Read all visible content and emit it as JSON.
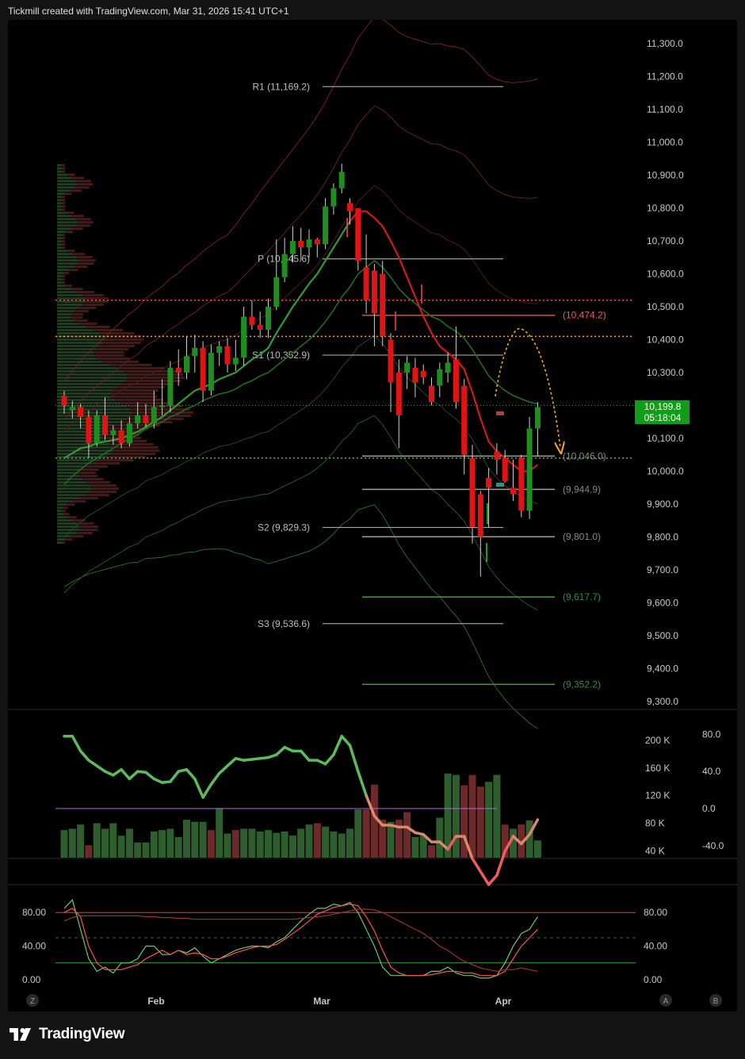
{
  "header": {
    "text": "Tickmill created with TradingView.com, Mar 31, 2026 15:41 UTC+1"
  },
  "brand": {
    "name": "TradingView",
    "icon": "tradingview-logo-icon"
  },
  "colors": {
    "up": "#1e8f1e",
    "down": "#e01414",
    "bg": "#000000",
    "price_badge": "#0f9d1a",
    "fib_orange": "#f5a623",
    "dotted_red": "#ff4444",
    "green_level": "#2a7a2a",
    "red_level": "#ff3b3b"
  },
  "price_badge": {
    "price": "10,199.8",
    "countdown": "05:18:04",
    "value": 10199.8
  },
  "pivots": [
    {
      "label": "R1 (11,169.2)",
      "value": 11169.2
    },
    {
      "label": "P (10,645.6)",
      "value": 10645.6
    },
    {
      "label": "S1 (10,352.9)",
      "value": 10352.9
    },
    {
      "label": "S2 (9,829.3)",
      "value": 9829.3
    },
    {
      "label": "S3 (9,536.6)",
      "value": 9536.6
    }
  ],
  "levels": [
    {
      "label": "(10,474.2)",
      "value": 10474.2,
      "color": "red"
    },
    {
      "label": "(10,046.0)",
      "value": 10046.0,
      "color": "gray"
    },
    {
      "label": "(9,944.9)",
      "value": 9944.9,
      "color": "gray"
    },
    {
      "label": "(9,801.0)",
      "value": 9801.0,
      "color": "gray"
    },
    {
      "label": "(9,617.7)",
      "value": 9617.7,
      "color": "green"
    },
    {
      "label": "(9,352.2)",
      "value": 9352.2,
      "color": "green"
    }
  ],
  "dotted_lines": [
    {
      "value": 10520,
      "color": "red"
    },
    {
      "value": 10410,
      "color": "orange"
    },
    {
      "value": 10040,
      "color": "green"
    },
    {
      "value": 10199.8,
      "color": "green"
    }
  ],
  "chart_data": [
    {
      "type": "candlestick",
      "title": "",
      "ylim": [
        9270,
        11330
      ],
      "y_ticks": [
        "11,300.0",
        "11,200.0",
        "11,100.0",
        "11,000.0",
        "10,900.0",
        "10,800.0",
        "10,700.0",
        "10,600.0",
        "10,500.0",
        "10,400.0",
        "10,300.0",
        "10,200.0",
        "10,100.0",
        "10,000.0",
        "9,900.0",
        "9,800.0",
        "9,700.0",
        "9,600.0",
        "9,500.0",
        "9,400.0",
        "9,300.0"
      ],
      "y_tick_values": [
        11300,
        11200,
        11100,
        11000,
        10900,
        10800,
        10700,
        10600,
        10500,
        10400,
        10300,
        10200,
        10100,
        10000,
        9900,
        9800,
        9700,
        9600,
        9500,
        9400,
        9300
      ],
      "x_ticks": [
        "Feb",
        "Mar",
        "Apr"
      ],
      "x_tick_index": [
        15,
        41,
        70.5
      ],
      "candles": [
        [
          10230,
          10245,
          10175,
          10200
        ],
        [
          10185,
          10215,
          10160,
          10195
        ],
        [
          10195,
          10205,
          10130,
          10165
        ],
        [
          10165,
          10185,
          10040,
          10085
        ],
        [
          10085,
          10185,
          10075,
          10170
        ],
        [
          10170,
          10225,
          10095,
          10110
        ],
        [
          10110,
          10140,
          10080,
          10125
        ],
        [
          10125,
          10155,
          10070,
          10085
        ],
        [
          10085,
          10165,
          10075,
          10145
        ],
        [
          10145,
          10210,
          10130,
          10170
        ],
        [
          10170,
          10205,
          10135,
          10145
        ],
        [
          10145,
          10245,
          10130,
          10195
        ],
        [
          10195,
          10280,
          10170,
          10200
        ],
        [
          10200,
          10335,
          10180,
          10315
        ],
        [
          10315,
          10370,
          10260,
          10300
        ],
        [
          10300,
          10410,
          10280,
          10350
        ],
        [
          10350,
          10415,
          10300,
          10375
        ],
        [
          10375,
          10395,
          10210,
          10245
        ],
        [
          10245,
          10385,
          10230,
          10360
        ],
        [
          10360,
          10395,
          10320,
          10380
        ],
        [
          10380,
          10405,
          10300,
          10325
        ],
        [
          10325,
          10400,
          10305,
          10345
        ],
        [
          10345,
          10500,
          10320,
          10470
        ],
        [
          10470,
          10520,
          10430,
          10445
        ],
        [
          10445,
          10485,
          10405,
          10430
        ],
        [
          10430,
          10525,
          10405,
          10500
        ],
        [
          10500,
          10705,
          10490,
          10590
        ],
        [
          10590,
          10710,
          10575,
          10660
        ],
        [
          10660,
          10745,
          10635,
          10700
        ],
        [
          10700,
          10740,
          10640,
          10680
        ],
        [
          10680,
          10735,
          10650,
          10705
        ],
        [
          10705,
          10710,
          10650,
          10690
        ],
        [
          10690,
          10830,
          10675,
          10805
        ],
        [
          10805,
          10875,
          10780,
          10860
        ],
        [
          10860,
          10935,
          10845,
          10910
        ],
        [
          10815,
          10830,
          10750,
          10790
        ],
        [
          10800,
          10800,
          10610,
          10640
        ],
        [
          10620,
          10720,
          10480,
          10520
        ],
        [
          10610,
          10630,
          10380,
          10480
        ],
        [
          10600,
          10640,
          10380,
          10410
        ],
        [
          10400,
          10420,
          10180,
          10270
        ],
        [
          10300,
          10340,
          10070,
          10170
        ],
        [
          10300,
          10350,
          10250,
          10330
        ],
        [
          10315,
          10345,
          10225,
          10270
        ],
        [
          10305,
          10325,
          10265,
          10285
        ],
        [
          10260,
          10285,
          10200,
          10210
        ],
        [
          10260,
          10330,
          10225,
          10310
        ],
        [
          10300,
          10360,
          10270,
          10330
        ],
        [
          10340,
          10440,
          10190,
          10210
        ],
        [
          10260,
          10280,
          9990,
          10050
        ],
        [
          10040,
          10080,
          9780,
          9830
        ],
        [
          9930,
          9940,
          9680,
          9800
        ],
        [
          9980,
          10010,
          9830,
          9950
        ],
        [
          10060,
          10085,
          9990,
          10035
        ],
        [
          10040,
          10065,
          9965,
          9970
        ],
        [
          9950,
          10035,
          9910,
          9930
        ],
        [
          10040,
          10050,
          9860,
          9880
        ],
        [
          9880,
          10165,
          9855,
          10130
        ],
        [
          10130,
          10210,
          10045,
          10195
        ]
      ],
      "series": [
        {
          "name": "",
          "type": "ema_fast",
          "values": [
            10040,
            10055,
            10070,
            10075,
            10085,
            10090,
            10095,
            10100,
            10110,
            10120,
            10135,
            10150,
            10165,
            10185,
            10205,
            10225,
            10245,
            10255,
            10265,
            10280,
            10290,
            10300,
            10320,
            10340,
            10355,
            10375,
            10420,
            10460,
            10500,
            10535,
            10570,
            10600,
            10640,
            10680,
            10720,
            10760,
            10790,
            10790,
            10770,
            10745,
            10700,
            10650,
            10590,
            10530,
            10470,
            10420,
            10380,
            10360,
            10340,
            10310,
            10240,
            10160,
            10090,
            10060,
            10040,
            10020,
            10000,
            10000,
            10020
          ]
        },
        {
          "name": "",
          "type": "ema_slow",
          "values": [
            9960,
            9985,
            10005,
            10025,
            10040,
            10055,
            10070,
            10085,
            10100,
            10110,
            10130,
            10140,
            10150,
            10165,
            10175,
            10190,
            10200,
            10215,
            10225,
            10235,
            10240,
            10250,
            10265,
            10275,
            10290,
            10300,
            10320,
            10340,
            10360,
            10380,
            10400,
            10425,
            10455,
            10490,
            10530,
            10560,
            10600,
            10620,
            10640,
            10620,
            10590,
            10555,
            10530,
            10510,
            10490,
            10470,
            10460,
            10440,
            10425,
            10405,
            10370,
            10330,
            10290,
            10265,
            10245,
            10230,
            10220,
            10210,
            10205
          ]
        }
      ]
    },
    {
      "type": "bar",
      "title": "",
      "y_ticks": [
        "200 K",
        "160 K",
        "120 K",
        "80 K",
        "40 K"
      ],
      "y_tick_values": [
        200,
        160,
        120,
        80,
        40
      ],
      "right_ticks": [
        "80.0",
        "40.0",
        "0.0",
        "-40.0"
      ],
      "right_tick_values": [
        80,
        40,
        0,
        -40
      ],
      "volume_k": [
        70,
        72,
        78,
        48,
        80,
        72,
        80,
        62,
        72,
        52,
        52,
        68,
        70,
        72,
        60,
        85,
        82,
        82,
        70,
        102,
        65,
        70,
        72,
        72,
        68,
        70,
        66,
        68,
        62,
        72,
        78,
        80,
        75,
        68,
        65,
        72,
        100,
        100,
        136,
        85,
        82,
        85,
        96,
        60,
        62,
        48,
        88,
        152,
        150,
        135,
        150,
        133,
        140,
        150,
        78,
        72,
        78,
        84,
        55
      ],
      "volume_up": [
        1,
        1,
        1,
        0,
        1,
        1,
        1,
        1,
        1,
        1,
        1,
        1,
        1,
        1,
        1,
        1,
        1,
        1,
        0,
        1,
        1,
        0,
        1,
        1,
        1,
        1,
        1,
        1,
        1,
        1,
        1,
        0,
        1,
        1,
        1,
        1,
        1,
        0,
        0,
        0,
        1,
        0,
        0,
        1,
        1,
        0,
        1,
        1,
        1,
        0,
        0,
        0,
        1,
        1,
        0,
        1,
        0,
        1,
        1
      ],
      "oscillator": [
        78,
        78,
        62,
        52,
        46,
        40,
        36,
        42,
        32,
        40,
        39,
        32,
        28,
        29,
        40,
        42,
        32,
        12,
        26,
        38,
        46,
        54,
        52,
        53,
        54,
        55,
        58,
        66,
        62,
        62,
        52,
        52,
        48,
        58,
        78,
        68,
        40,
        14,
        -8,
        -18,
        -18,
        -20,
        -20,
        -26,
        -28,
        -36,
        -36,
        -44,
        -30,
        -30,
        -54,
        -68,
        -82,
        -72,
        -46,
        -30,
        -38,
        -28,
        -12
      ],
      "oscillator_ylim": [
        -65,
        95
      ],
      "hline_value": 0
    },
    {
      "type": "line",
      "title": "",
      "ylim": [
        -5,
        100
      ],
      "y_ticks": [
        "80.00",
        "40.00",
        "0.00"
      ],
      "y_tick_values": [
        80,
        40,
        0
      ],
      "right_ticks": [
        "80.00",
        "40.00",
        "0.00"
      ],
      "hlines": [
        80,
        50,
        20
      ],
      "series": [
        {
          "name": "",
          "color": "#66cc66",
          "values": [
            85,
            95,
            60,
            25,
            10,
            15,
            8,
            20,
            20,
            25,
            40,
            40,
            30,
            30,
            35,
            32,
            38,
            28,
            20,
            25,
            30,
            35,
            38,
            40,
            40,
            38,
            45,
            50,
            60,
            70,
            78,
            85,
            85,
            90,
            88,
            92,
            80,
            60,
            40,
            15,
            5,
            5,
            5,
            5,
            5,
            10,
            10,
            15,
            8,
            5,
            5,
            2,
            2,
            5,
            20,
            40,
            55,
            60,
            75
          ]
        },
        {
          "name": "",
          "color": "#ff5252",
          "values": [
            80,
            85,
            75,
            40,
            20,
            12,
            12,
            12,
            15,
            18,
            25,
            30,
            35,
            30,
            35,
            30,
            32,
            30,
            25,
            25,
            28,
            32,
            35,
            38,
            40,
            40,
            42,
            48,
            55,
            62,
            70,
            78,
            82,
            86,
            88,
            90,
            88,
            75,
            58,
            35,
            15,
            8,
            5,
            5,
            5,
            6,
            8,
            10,
            10,
            8,
            8,
            5,
            5,
            5,
            10,
            25,
            40,
            50,
            60
          ]
        },
        {
          "name": "",
          "color": "#a03030",
          "values": [
            70,
            74,
            76,
            76,
            76,
            76,
            76,
            76,
            76,
            76,
            75,
            75,
            74,
            74,
            73,
            73,
            72,
            72,
            72,
            72,
            72,
            72,
            72,
            72,
            72,
            72,
            72,
            72,
            72,
            73,
            74,
            75,
            76,
            78,
            80,
            82,
            84,
            84,
            83,
            80,
            75,
            70,
            65,
            60,
            55,
            48,
            40,
            35,
            28,
            22,
            18,
            14,
            12,
            10,
            12,
            12,
            14,
            12,
            10
          ]
        }
      ],
      "x_ticks": [
        "Feb",
        "Mar",
        "Apr"
      ]
    }
  ],
  "bottom_buttons": [
    "Z",
    "A",
    "B"
  ]
}
